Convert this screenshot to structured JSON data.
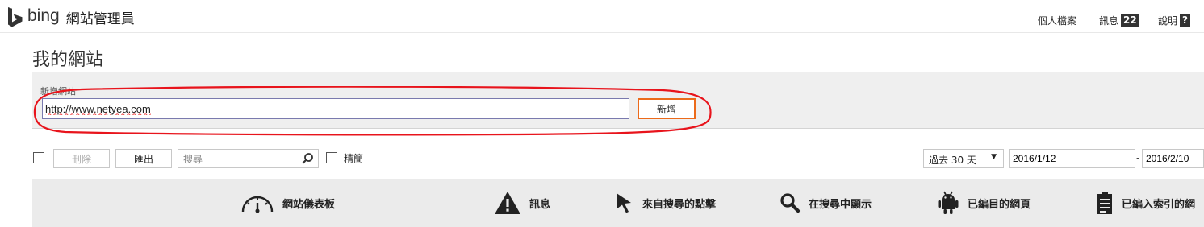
{
  "header": {
    "logo_text": "bing",
    "product_name": "網站管理員",
    "links": {
      "profile": "個人檔案",
      "messages": "訊息",
      "messages_count": "22",
      "help": "說明",
      "help_badge": "?"
    }
  },
  "page": {
    "title": "我的網站"
  },
  "add_site": {
    "label": "新增網站",
    "url_value": "http://www.netyea.com",
    "add_button": "新增"
  },
  "toolbar": {
    "delete_label": "刪除",
    "export_label": "匯出",
    "search_placeholder": "搜尋",
    "compact_label": "精簡",
    "period_value": "過去 30 天",
    "date_from": "2016/1/12",
    "date_to": "2016/2/10",
    "date_sep": "-"
  },
  "tabs": [
    {
      "label": "網站儀表板",
      "icon": "gauge-icon"
    },
    {
      "label": "訊息",
      "icon": "warning-icon"
    },
    {
      "label": "來自搜尋的點擊",
      "icon": "cursor-icon"
    },
    {
      "label": "在搜尋中顯示",
      "icon": "search-icon"
    },
    {
      "label": "已編目的網頁",
      "icon": "robot-icon"
    },
    {
      "label": "已編入索引的網",
      "icon": "document-icon"
    }
  ],
  "colors": {
    "accent_orange": "#ec6a1a",
    "annotation_red": "#e8141c",
    "panel_gray": "#efefef",
    "tabbar_gray": "#ebebeb"
  }
}
